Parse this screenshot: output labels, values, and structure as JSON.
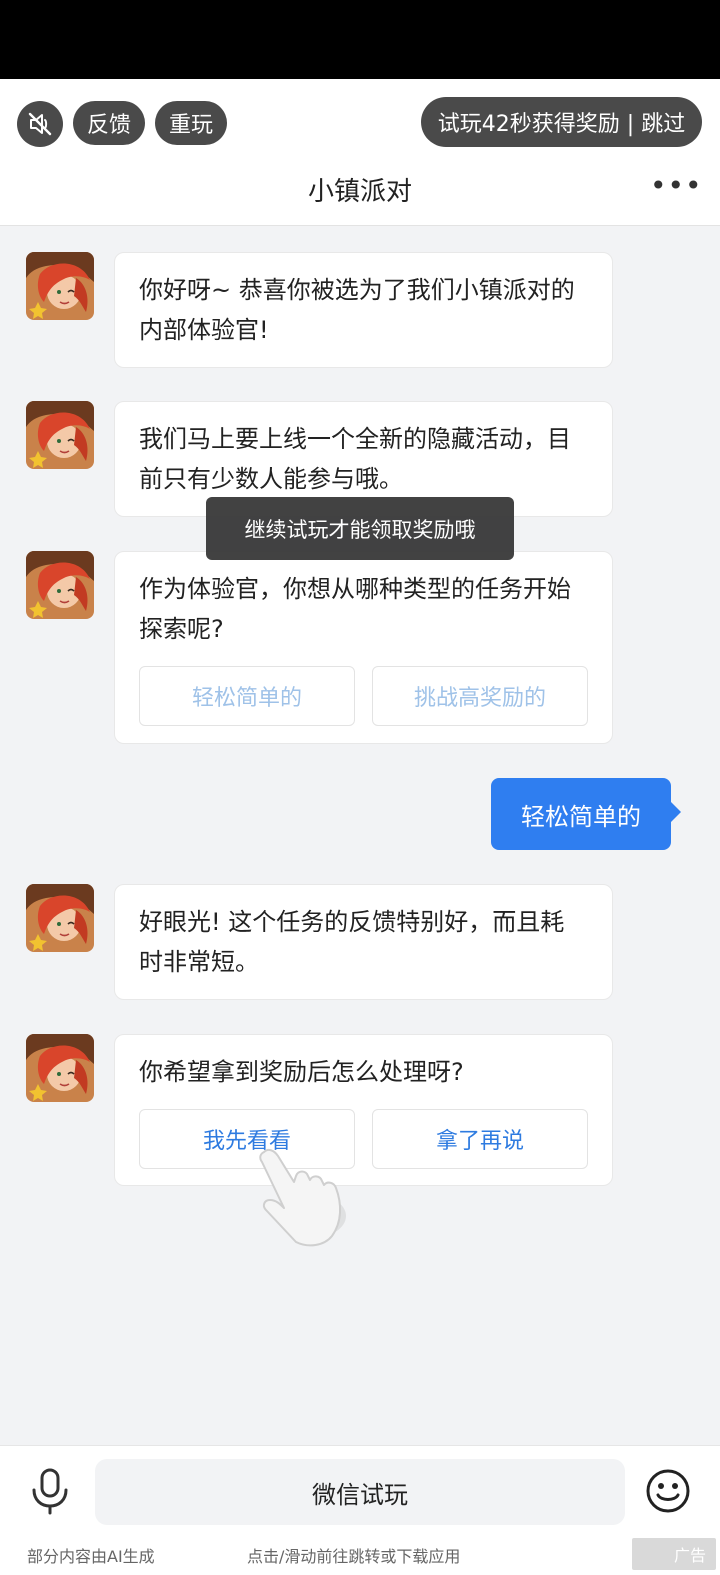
{
  "header": {
    "feedback_label": "反馈",
    "replay_label": "重玩",
    "trial_label": "试玩42秒获得奖励 | 跳过",
    "title": "小镇派对",
    "more_label": "•••"
  },
  "messages": [
    {
      "text": "你好呀~ 恭喜你被选为了我们小镇派对的内部体验官!"
    },
    {
      "text": "我们马上要上线一个全新的隐藏活动，目前只有少数人能参与哦。"
    },
    {
      "text": "作为体验官，你想从哪种类型的任务开始探索呢?",
      "options": [
        "轻松简单的",
        "挑战高奖励的"
      ]
    },
    {
      "text": "好眼光! 这个任务的反馈特别好，而且耗时非常短。"
    },
    {
      "text": "你希望拿到奖励后怎么处理呀?",
      "options": [
        "我先看看",
        "拿了再说"
      ]
    }
  ],
  "user_reply": "轻松简单的",
  "toast": "继续试玩才能领取奖励哦",
  "footer": {
    "input_label": "微信试玩",
    "ai_note": "部分内容由AI生成",
    "tap_note": "点击/滑动前往跳转或下载应用",
    "ad_label": "广告"
  },
  "colors": {
    "accent": "#2f7ef0",
    "pill_bg": "#4a4a4a",
    "chat_bg": "#f2f3f5"
  }
}
